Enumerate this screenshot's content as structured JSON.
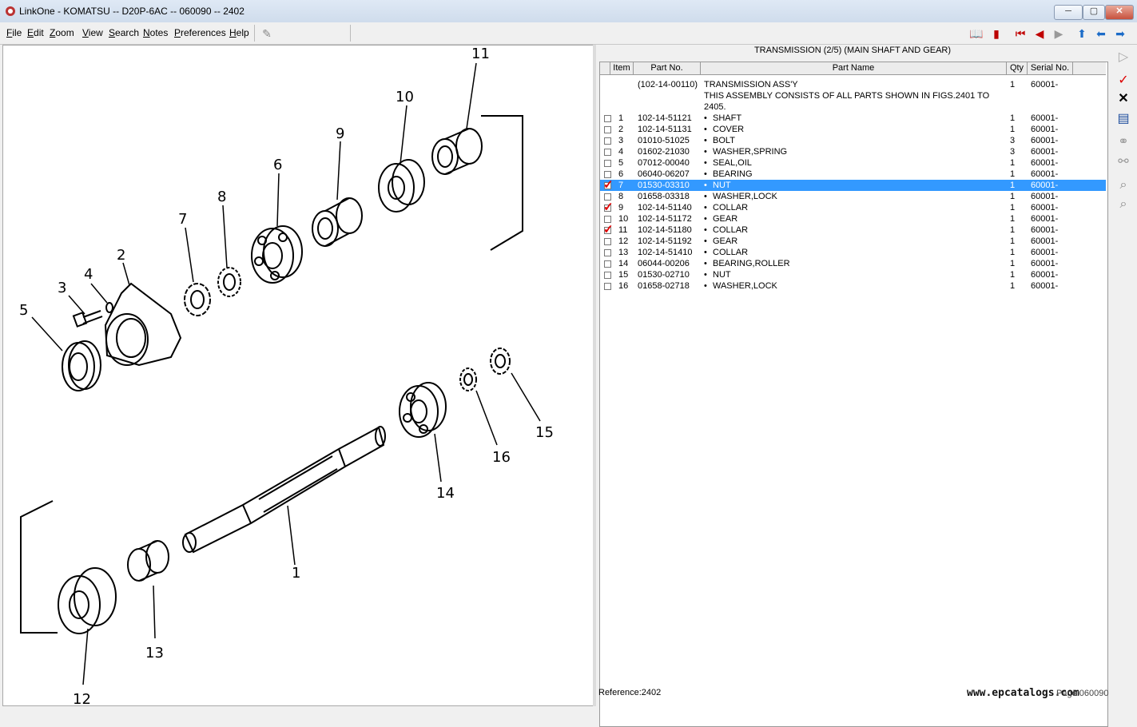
{
  "window": {
    "title": "LinkOne - KOMATSU -- D20P-6AC -- 060090 -- 2402",
    "min": "─",
    "max": "▢",
    "close": "✕"
  },
  "menu": [
    "File",
    "Edit",
    "Zoom",
    "View",
    "Search",
    "Notes",
    "Preferences",
    "Help"
  ],
  "parts": {
    "title": "TRANSMISSION (2/5) (MAIN SHAFT AND GEAR)",
    "columns": [
      "Item",
      "Part No.",
      "Part Name",
      "Qty",
      "Serial No."
    ],
    "assembly": {
      "part_no": "(102-14-00110)",
      "name_lines": [
        "TRANSMISSION ASS'Y",
        "THIS ASSEMBLY CONSISTS OF ALL PARTS SHOWN IN FIGS.2401 TO",
        "2405."
      ],
      "qty": "1",
      "serial": "60001-"
    },
    "rows": [
      {
        "item": "1",
        "part_no": "102-14-51121",
        "name": "SHAFT",
        "qty": "1",
        "serial": "60001-",
        "checked": false
      },
      {
        "item": "2",
        "part_no": "102-14-51131",
        "name": "COVER",
        "qty": "1",
        "serial": "60001-",
        "checked": false
      },
      {
        "item": "3",
        "part_no": "01010-51025",
        "name": "BOLT",
        "qty": "3",
        "serial": "60001-",
        "checked": false
      },
      {
        "item": "4",
        "part_no": "01602-21030",
        "name": "WASHER,SPRING",
        "qty": "3",
        "serial": "60001-",
        "checked": false
      },
      {
        "item": "5",
        "part_no": "07012-00040",
        "name": "SEAL,OIL",
        "qty": "1",
        "serial": "60001-",
        "checked": false
      },
      {
        "item": "6",
        "part_no": "06040-06207",
        "name": "BEARING",
        "qty": "1",
        "serial": "60001-",
        "checked": false
      },
      {
        "item": "7",
        "part_no": "01530-03310",
        "name": "NUT",
        "qty": "1",
        "serial": "60001-",
        "checked": true,
        "selected": true
      },
      {
        "item": "8",
        "part_no": "01658-03318",
        "name": "WASHER,LOCK",
        "qty": "1",
        "serial": "60001-",
        "checked": false
      },
      {
        "item": "9",
        "part_no": "102-14-51140",
        "name": "COLLAR",
        "qty": "1",
        "serial": "60001-",
        "checked": true
      },
      {
        "item": "10",
        "part_no": "102-14-51172",
        "name": "GEAR",
        "qty": "1",
        "serial": "60001-",
        "checked": false
      },
      {
        "item": "11",
        "part_no": "102-14-51180",
        "name": "COLLAR",
        "qty": "1",
        "serial": "60001-",
        "checked": true
      },
      {
        "item": "12",
        "part_no": "102-14-51192",
        "name": "GEAR",
        "qty": "1",
        "serial": "60001-",
        "checked": false
      },
      {
        "item": "13",
        "part_no": "102-14-51410",
        "name": "COLLAR",
        "qty": "1",
        "serial": "60001-",
        "checked": false
      },
      {
        "item": "14",
        "part_no": "06044-00206",
        "name": "BEARING,ROLLER",
        "qty": "1",
        "serial": "60001-",
        "checked": false
      },
      {
        "item": "15",
        "part_no": "01530-02710",
        "name": "NUT",
        "qty": "1",
        "serial": "60001-",
        "checked": false
      },
      {
        "item": "16",
        "part_no": "01658-02718",
        "name": "WASHER,LOCK",
        "qty": "1",
        "serial": "60001-",
        "checked": false
      }
    ]
  },
  "footer": {
    "reference": "Reference:2402",
    "watermark": "www.epcatalogs.com",
    "page": "Page:060090"
  },
  "drawing_labels": [
    "1",
    "2",
    "3",
    "4",
    "5",
    "6",
    "7",
    "8",
    "9",
    "10",
    "11",
    "12",
    "13",
    "14",
    "15",
    "16"
  ],
  "icons": {
    "toolbar": [
      "book-icon",
      "notes-icon",
      "first-icon",
      "prev-icon",
      "next-icon",
      "up-icon",
      "back-icon",
      "forward-icon"
    ],
    "sidebar": [
      "play-icon",
      "check-icon",
      "close-icon",
      "list-icon",
      "link-icon",
      "unlink-icon",
      "binoculars-icon",
      "search-icon"
    ]
  },
  "colors": {
    "selection": "#3399ff",
    "check": "#dd0000",
    "nav_arrows_red": "#c00000",
    "nav_arrows_blue": "#1c6cc8"
  }
}
